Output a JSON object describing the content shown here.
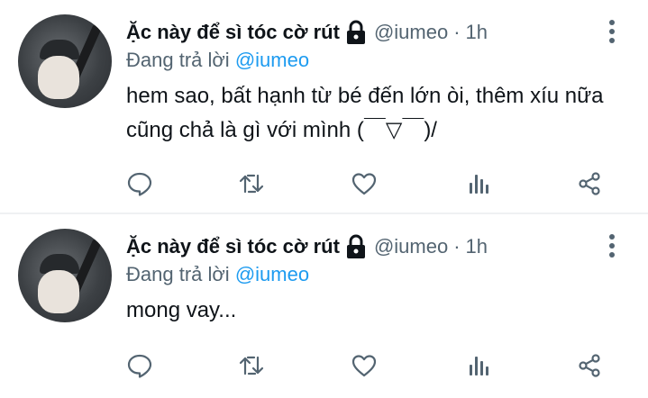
{
  "tweets": [
    {
      "display_name": "Ặc này để sì tóc cờ rút",
      "handle": "@iumeo",
      "separator": "·",
      "time": "1h",
      "replying_prefix": "Đang trả lời",
      "replying_to": "@iumeo",
      "text": "hem sao, bất hạnh từ bé đến lớn òi, thêm xíu nữa cũng chả là gì với mình (￣▽￣)/"
    },
    {
      "display_name": "Ặc này để sì tóc cờ rút",
      "handle": "@iumeo",
      "separator": "·",
      "time": "1h",
      "replying_prefix": "Đang trả lời",
      "replying_to": "@iumeo",
      "text": "mong vay..."
    }
  ],
  "icons": {
    "protected": "lock-icon",
    "more": "more-vertical-icon",
    "reply": "reply-icon",
    "retweet": "retweet-icon",
    "like": "heart-icon",
    "analytics": "analytics-icon",
    "share": "share-icon"
  },
  "colors": {
    "text": "#0f1419",
    "secondary": "#536471",
    "mention": "#1d9bf0",
    "divider": "#eff1f3"
  }
}
